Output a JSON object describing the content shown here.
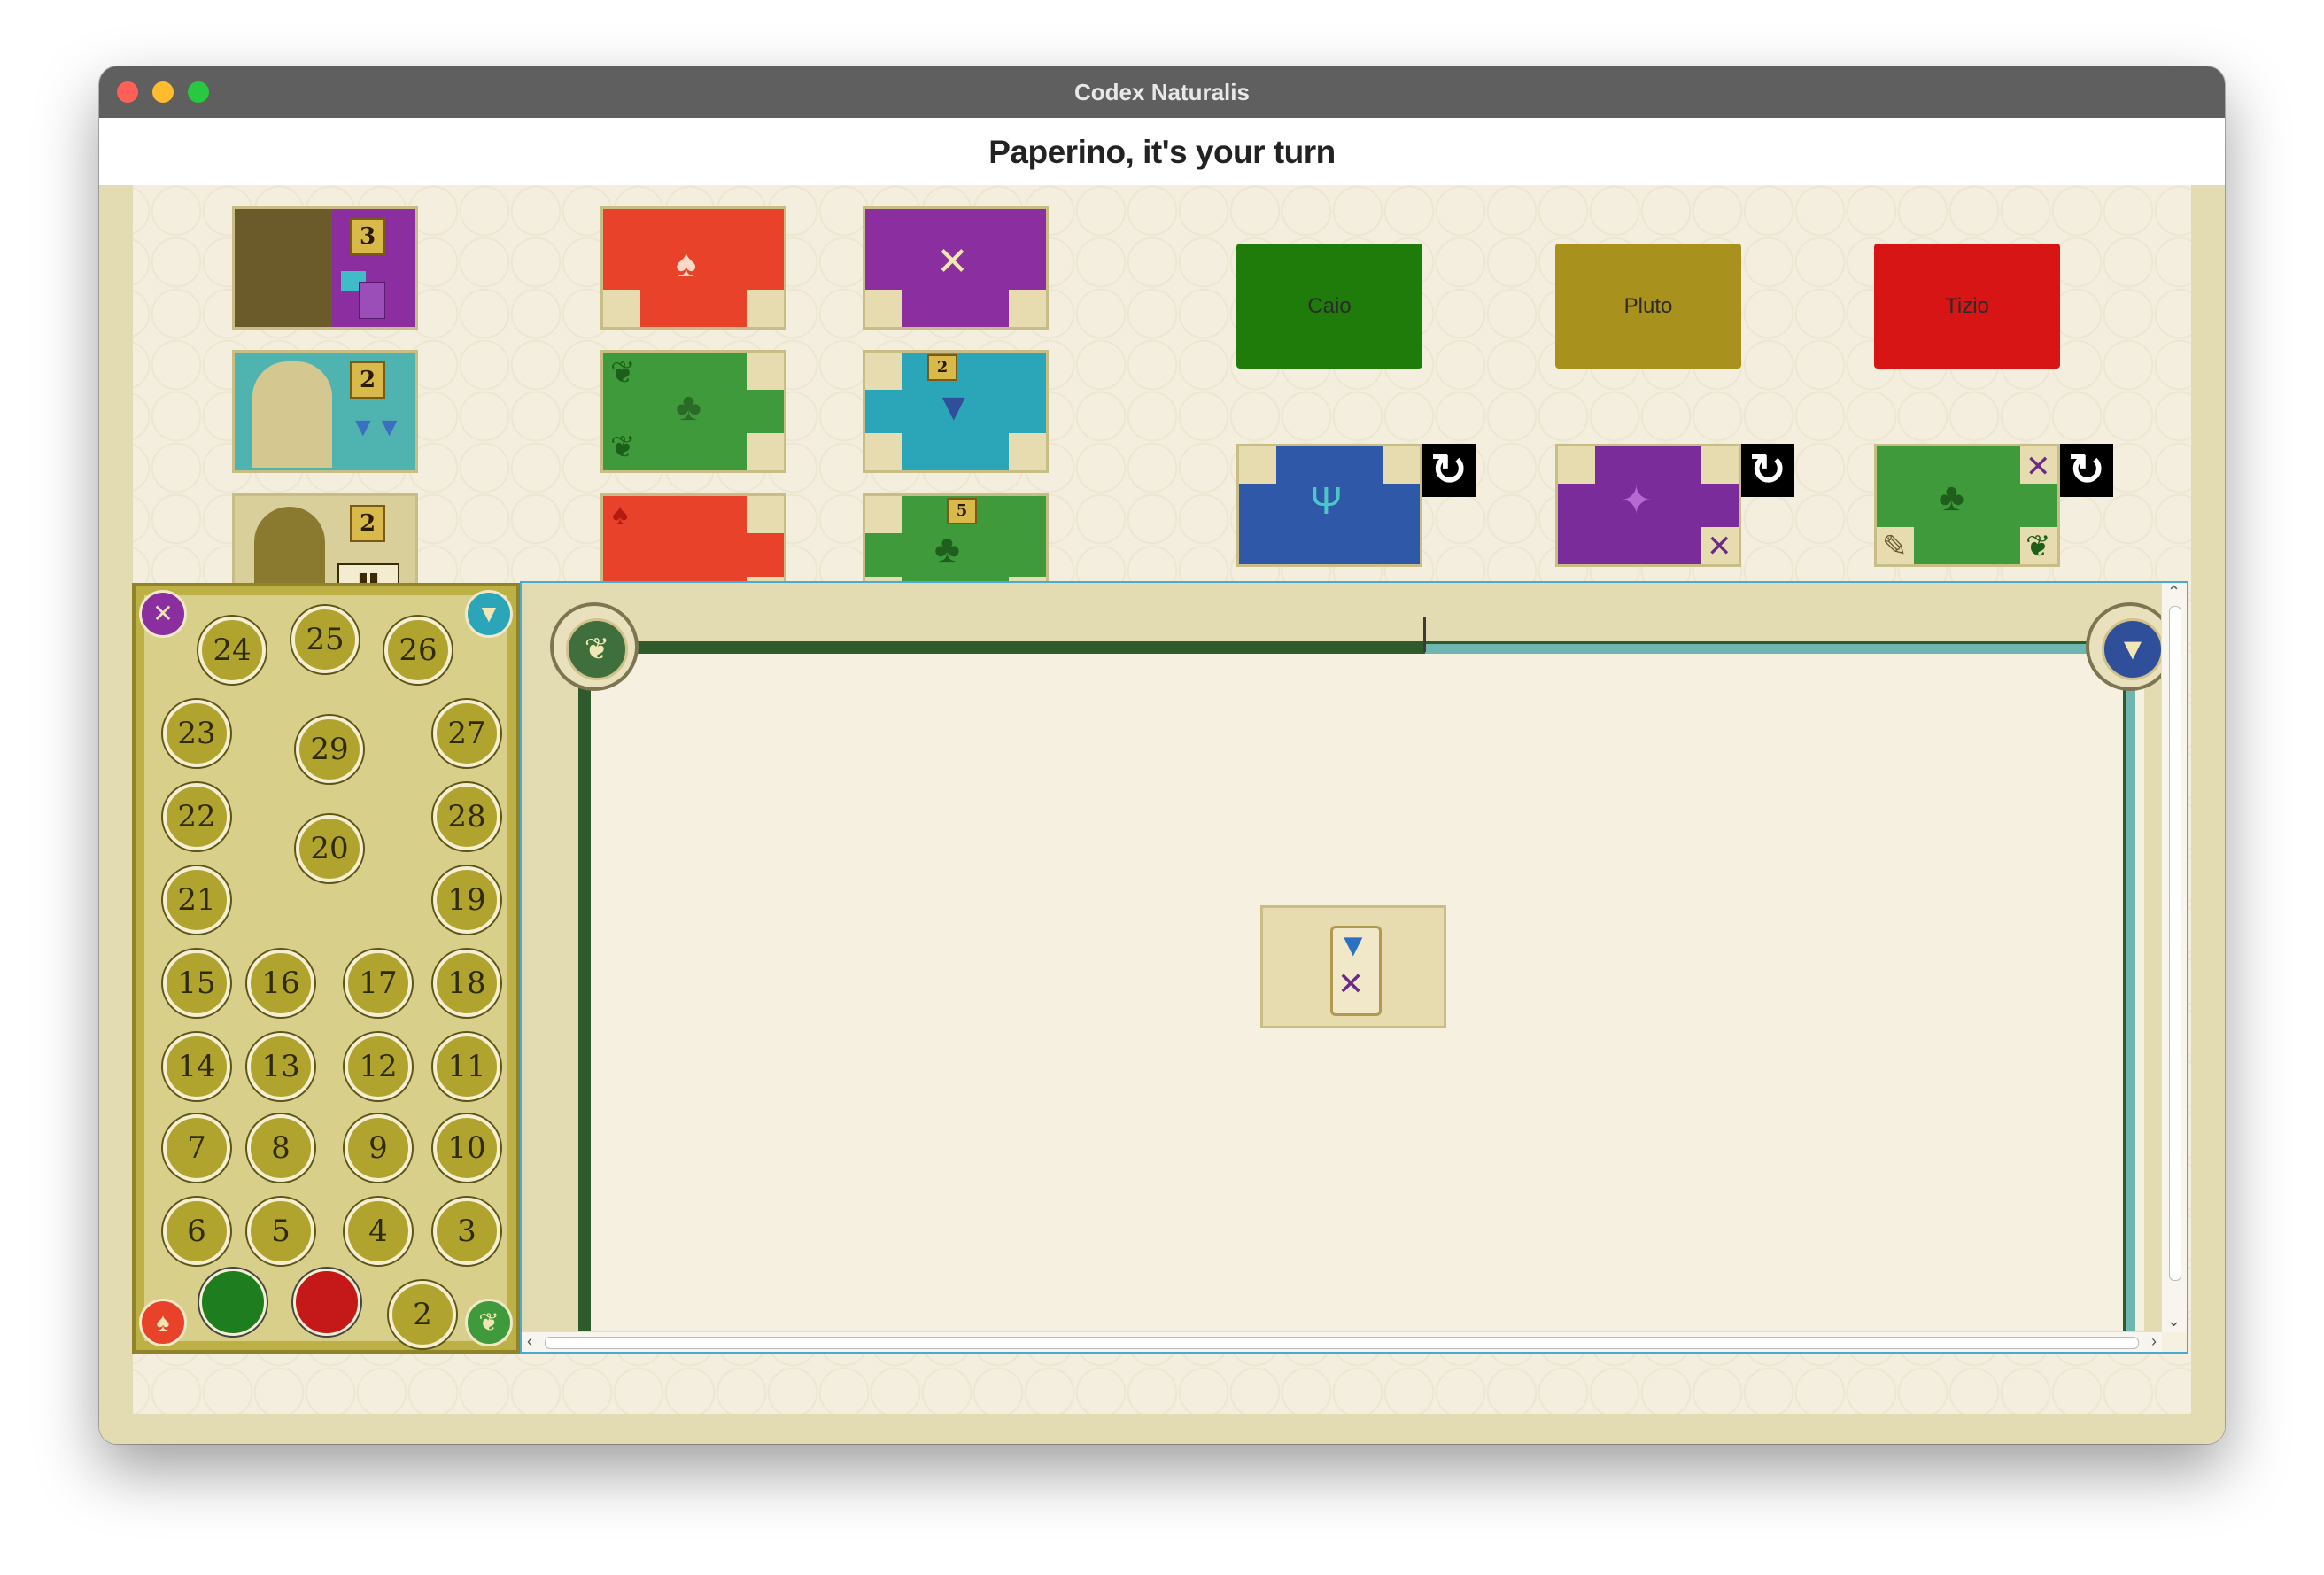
{
  "window": {
    "title": "Codex Naturalis",
    "traffic_lights": [
      "#ff5f57",
      "#febc2e",
      "#28c840"
    ]
  },
  "header": {
    "turn_text": "Paperino, it's your turn"
  },
  "objective_cards": [
    {
      "points": "3",
      "color": "#8a2ea0"
    },
    {
      "points": "2",
      "color": "#4fb3b0"
    },
    {
      "points": "2",
      "color": "#d9cf9a"
    }
  ],
  "draw_resource_cards": [
    {
      "kingdom": "fungi",
      "color": "#e8432a",
      "icon": "mushroom-icon"
    },
    {
      "kingdom": "plant",
      "color": "#3e9a3a",
      "icon": "leaf-icon"
    },
    {
      "kingdom": "fungi",
      "color": "#e8432a",
      "icon": "mushroom-icon"
    }
  ],
  "draw_gold_cards": [
    {
      "kingdom": "insect",
      "color": "#8a2ea0",
      "icon": "butterfly-icon"
    },
    {
      "kingdom": "animal",
      "color": "#2aa6b8",
      "points": "2",
      "icon": "wolf-icon"
    },
    {
      "kingdom": "plant",
      "color": "#3e9a3a",
      "points": "5",
      "icon": "tree-icon"
    }
  ],
  "players": [
    {
      "name": "Caio",
      "color": "#207c0a",
      "card_color": "#2f58a8",
      "icon": "stag-icon"
    },
    {
      "name": "Pluto",
      "color": "#a8911c",
      "card_color": "#7a2d9a",
      "icon": "dragonfly-icon"
    },
    {
      "name": "Tizio",
      "color": "#d81515",
      "card_color": "#3e9a3a",
      "icon": "tree-icon"
    }
  ],
  "scoreboard": {
    "numbers": [
      "24",
      "25",
      "26",
      "23",
      "29",
      "27",
      "22",
      "28",
      "20",
      "21",
      "19",
      "15",
      "16",
      "17",
      "18",
      "14",
      "13",
      "12",
      "11",
      "7",
      "8",
      "9",
      "10",
      "6",
      "5",
      "4",
      "3",
      "2"
    ],
    "pawns": [
      {
        "color": "#1e7d1e"
      },
      {
        "color": "#c51818"
      }
    ]
  },
  "board": {
    "starter_card": {
      "icons": [
        "wolf-icon",
        "butterfly-icon"
      ]
    },
    "left_medal": "leaf-icon",
    "right_medal": "wolf-icon"
  }
}
